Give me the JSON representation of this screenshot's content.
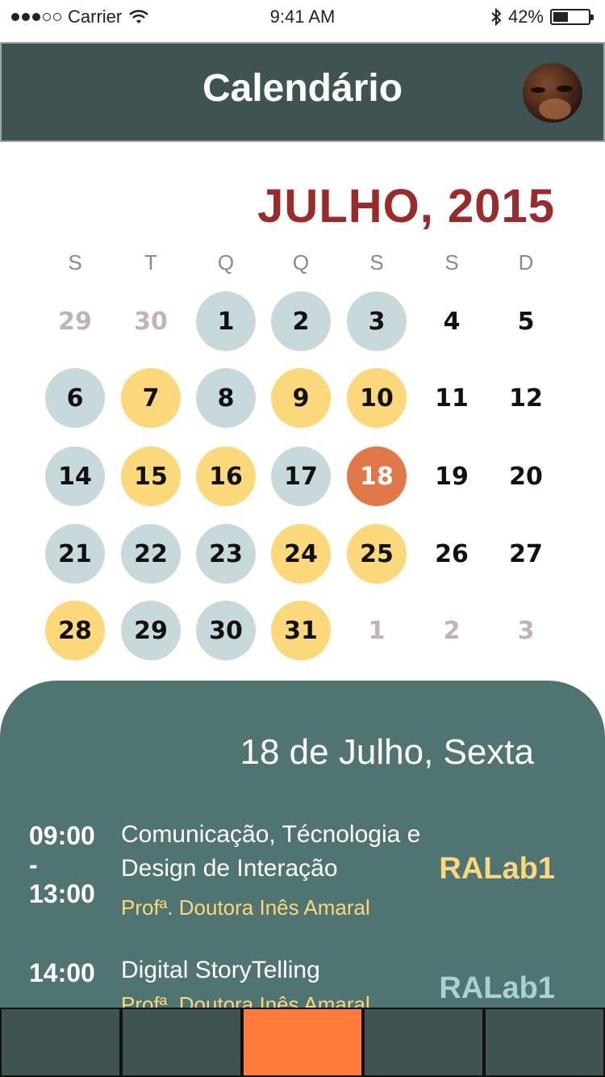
{
  "status_bar": {
    "carrier": "Carrier",
    "time": "9:41 AM",
    "battery_percent": "42%",
    "battery_level": 0.42,
    "signal_bars_filled": 3,
    "signal_bars_total": 5,
    "icons": [
      "wifi-icon",
      "bluetooth-icon",
      "battery-icon"
    ]
  },
  "header": {
    "title": "Calendário",
    "avatar_icon": "avatar"
  },
  "calendar": {
    "month_title": "JULHO, 2015",
    "weekdays": [
      "S",
      "T",
      "Q",
      "Q",
      "S",
      "S",
      "D"
    ],
    "days": [
      {
        "label": "29",
        "state": "muted"
      },
      {
        "label": "30",
        "state": "muted"
      },
      {
        "label": "1",
        "state": "blue"
      },
      {
        "label": "2",
        "state": "blue"
      },
      {
        "label": "3",
        "state": "blue"
      },
      {
        "label": "4",
        "state": "plain"
      },
      {
        "label": "5",
        "state": "plain"
      },
      {
        "label": "6",
        "state": "blue"
      },
      {
        "label": "7",
        "state": "yellow"
      },
      {
        "label": "8",
        "state": "blue"
      },
      {
        "label": "9",
        "state": "yellow"
      },
      {
        "label": "10",
        "state": "yellow"
      },
      {
        "label": "11",
        "state": "plain"
      },
      {
        "label": "12",
        "state": "plain"
      },
      {
        "label": "14",
        "state": "blue"
      },
      {
        "label": "15",
        "state": "yellow"
      },
      {
        "label": "16",
        "state": "yellow"
      },
      {
        "label": "17",
        "state": "blue"
      },
      {
        "label": "18",
        "state": "today"
      },
      {
        "label": "19",
        "state": "plain"
      },
      {
        "label": "20",
        "state": "plain"
      },
      {
        "label": "21",
        "state": "blue"
      },
      {
        "label": "22",
        "state": "blue"
      },
      {
        "label": "23",
        "state": "blue"
      },
      {
        "label": "24",
        "state": "yellow"
      },
      {
        "label": "25",
        "state": "yellow"
      },
      {
        "label": "26",
        "state": "plain"
      },
      {
        "label": "27",
        "state": "plain"
      },
      {
        "label": "28",
        "state": "yellow"
      },
      {
        "label": "29",
        "state": "blue"
      },
      {
        "label": "30",
        "state": "blue"
      },
      {
        "label": "31",
        "state": "yellow"
      },
      {
        "label": "1",
        "state": "muted"
      },
      {
        "label": "2",
        "state": "muted"
      },
      {
        "label": "3",
        "state": "muted"
      }
    ]
  },
  "events": {
    "selected_date": "18 de Julho, Sexta",
    "items": [
      {
        "time_start": "09:00",
        "time_sep": "-",
        "time_end": "13:00",
        "title": "Comunicação, Técnologia e Design de Interação",
        "professor": "Profª. Doutora Inês Amaral",
        "room": "RALab1"
      },
      {
        "time_start": "14:00",
        "time_sep": "",
        "time_end": "",
        "title": "Digital StoryTelling",
        "professor": "Profª. Doutora Inês Amaral",
        "room": "RALab1"
      }
    ]
  },
  "tabbar": {
    "active_index": 2,
    "tab_count": 5
  },
  "colors": {
    "header_bg": "#3f5352",
    "month_title": "#9b2a2a",
    "day_blue": "#c7d9da",
    "day_yellow": "#fbd97a",
    "day_today": "#e07847",
    "panel_bg": "#507471",
    "professor_text": "#fbd97a",
    "room_first": "#fbd97a",
    "room_second": "#a9d2d3",
    "tab_active": "#ff7a3b"
  }
}
